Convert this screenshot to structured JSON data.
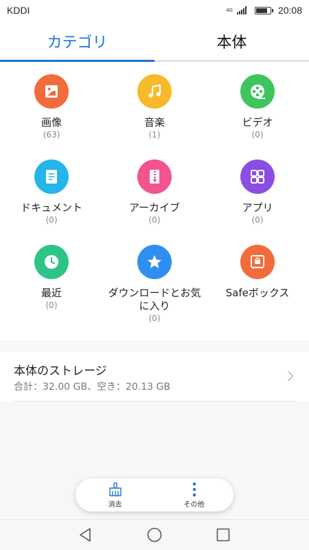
{
  "status_bar": {
    "carrier": "KDDI",
    "network": "4G",
    "time": "20:08",
    "battery_level": 0.85
  },
  "tabs": [
    {
      "label": "カテゴリ",
      "active": true
    },
    {
      "label": "本体",
      "active": false
    }
  ],
  "categories": [
    {
      "name": "画像",
      "count": "(63)",
      "icon": "image-icon",
      "color": "#f26b3a"
    },
    {
      "name": "音楽",
      "count": "(1)",
      "icon": "music-icon",
      "color": "#f8b92a"
    },
    {
      "name": "ビデオ",
      "count": "(0)",
      "icon": "film-reel-icon",
      "color": "#3ec55d"
    },
    {
      "name": "ドキュメント",
      "count": "(0)",
      "icon": "document-icon",
      "color": "#25b5e8"
    },
    {
      "name": "アーカイブ",
      "count": "(0)",
      "icon": "archive-icon",
      "color": "#f25490"
    },
    {
      "name": "アプリ",
      "count": "(0)",
      "icon": "apps-grid-icon",
      "color": "#8a4fe0"
    },
    {
      "name": "最近",
      "count": "(0)",
      "icon": "clock-icon",
      "color": "#2ec488"
    },
    {
      "name": "ダウンロードとお気に入り",
      "count": "(0)",
      "icon": "star-icon",
      "color": "#2f8ff0"
    },
    {
      "name": "Safeボックス",
      "count": "",
      "icon": "safe-icon",
      "color": "#f26b3a"
    }
  ],
  "storage": {
    "title": "本体のストレージ",
    "summary": "合計：32.00 GB、空き：20.13 GB"
  },
  "action_bar": {
    "clean_label": "消去",
    "more_label": "その他",
    "accent": "#1a73d8"
  },
  "nav": {
    "back": "back-icon",
    "home": "home-icon",
    "recents": "recents-icon"
  }
}
